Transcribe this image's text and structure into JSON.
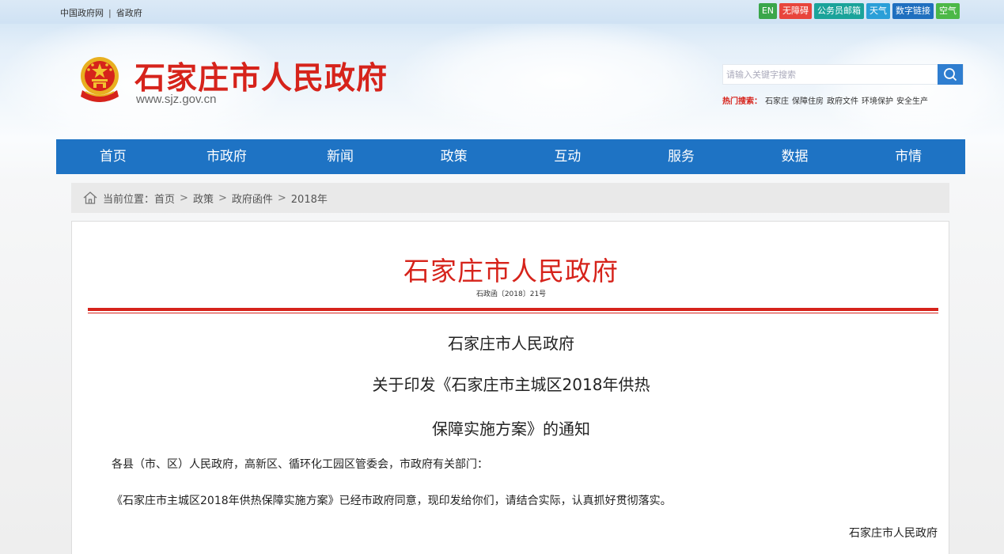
{
  "topbar": {
    "links": [
      "中国政府网",
      "省政府"
    ],
    "separator": "|",
    "badges": [
      {
        "label": "EN",
        "color": "#3aa64a"
      },
      {
        "label": "无障碍",
        "color": "#e8453c"
      },
      {
        "label": "公务员邮箱",
        "color": "#1aa39a"
      },
      {
        "label": "天气",
        "color": "#2a9fd8"
      },
      {
        "label": "数字链接",
        "color": "#1f6fbf"
      },
      {
        "label": "空气",
        "color": "#4cb848"
      }
    ]
  },
  "header": {
    "title": "石家庄市人民政府",
    "url": "www.sjz.gov.cn",
    "search_placeholder": "请输入关键字搜索",
    "hot_label": "热门搜索：",
    "hot_terms": [
      "石家庄",
      "保障住房",
      "政府文件",
      "环境保护",
      "安全生产"
    ]
  },
  "nav": {
    "items": [
      "首页",
      "市政府",
      "新闻",
      "政策",
      "互动",
      "服务",
      "数据",
      "市情"
    ]
  },
  "breadcrumb": {
    "label": "当前位置：",
    "items": [
      "首页",
      "政策",
      "政府函件",
      "2018年"
    ],
    "separator": ">"
  },
  "document": {
    "issuer": "石家庄市人民政府",
    "number": "石政函〔2018〕21号",
    "title_lines": [
      "石家庄市人民政府",
      "关于印发《石家庄市主城区2018年供热",
      "保障实施方案》的通知"
    ],
    "recipients": "各县（市、区）人民政府，高新区、循环化工园区管委会，市政府有关部门：",
    "body": "《石家庄市主城区2018年供热保障实施方案》已经市政府同意，现印发给你们，请结合实际，认真抓好贯彻落实。",
    "signature": "石家庄市人民政府"
  },
  "colors": {
    "brand_red": "#d6231b",
    "nav_blue": "#1e73c4"
  }
}
